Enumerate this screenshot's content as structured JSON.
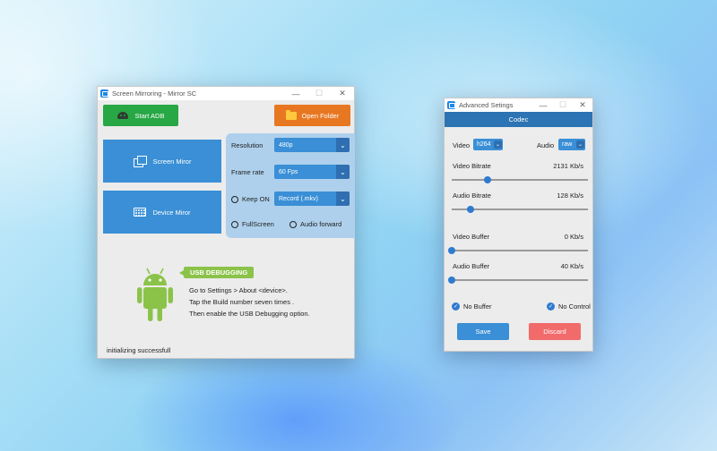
{
  "main_window": {
    "title": "Screen Mirroring - Mirror SC",
    "controls": {
      "minimize": "—",
      "maximize": "☐",
      "close": "✕"
    },
    "start_adb_label": "Start ADB",
    "open_folder_label": "Open Folder",
    "screen_mirror_label": "Screen Miror",
    "device_mirror_label": "Device Miror",
    "settings": {
      "resolution_label": "Resolution",
      "resolution_value": "480p",
      "frame_rate_label": "Frame rate",
      "frame_rate_value": "60 Fps",
      "keep_on_label": "Keep ON",
      "record_value": "Record (.mkv)",
      "fullscreen_label": "FullScreen",
      "audio_forward_label": "Audio forward"
    },
    "usb_debugging": {
      "tag": "USB DEBUGGING",
      "line1": "Go to Settings > About <device>.",
      "line2": "Tap the Build number seven times .",
      "line3": "Then enable the USB Debugging option."
    },
    "status": "initializing successfull"
  },
  "advanced_window": {
    "title": "Advanced Setings",
    "controls": {
      "minimize": "—",
      "maximize": "☐",
      "close": "✕"
    },
    "codec_header": "Codec",
    "video_label": "Video",
    "video_codec": "h264",
    "audio_label": "Audio",
    "audio_codec": "raw",
    "video_bitrate_label": "Video Bitrate",
    "video_bitrate_value": "2131 Kb/s",
    "video_bitrate_level": 0.26,
    "audio_bitrate_label": "Audio Bitrate",
    "audio_bitrate_value": "128 Kb/s",
    "audio_bitrate_level": 0.14,
    "video_buffer_label": "Video Buffer",
    "video_buffer_value": "0 Kb/s",
    "video_buffer_level": 0.0,
    "audio_buffer_label": "Audio Buffer",
    "audio_buffer_value": "40 Kb/s",
    "audio_buffer_level": 0.0,
    "no_buffer_label": "No Buffer",
    "no_control_label": "No Control",
    "save_label": "Save",
    "discard_label": "Discard"
  },
  "colors": {
    "accent_blue": "#3a8fd6",
    "green": "#28a745",
    "orange": "#e87722",
    "codec_bar": "#2c74b3",
    "discard_red": "#f26b6b",
    "android_green": "#8bc34a"
  },
  "icons": [
    "app-icon",
    "android-icon",
    "folder-icon",
    "screen-mirror-icon",
    "keyboard-icon",
    "android-robot-icon",
    "check-icon"
  ]
}
